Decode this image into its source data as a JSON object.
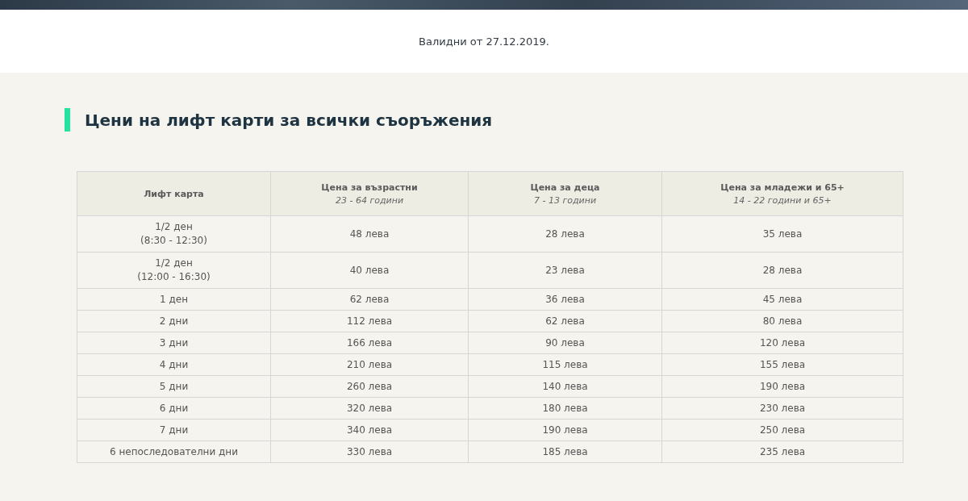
{
  "valid_from": "Валидни от 27.12.2019.",
  "section_title": "Цени на лифт карти за всички съоръжения",
  "table": {
    "columns": [
      {
        "title": "Лифт карта"
      },
      {
        "title": "Цена за възрастни",
        "subtitle": "23 - 64 години"
      },
      {
        "title": "Цена за деца",
        "subtitle": "7 - 13 години"
      },
      {
        "title": "Цена за младежи и 65+",
        "subtitle": "14 - 22 години и 65+"
      }
    ],
    "rows": [
      [
        "1/2 ден\n(8:30 - 12:30)",
        "48 лева",
        "28 лева",
        "35 лева"
      ],
      [
        "1/2 ден\n(12:00 - 16:30)",
        "40 лева",
        "23 лева",
        "28 лева"
      ],
      [
        "1 ден",
        "62 лева",
        "36 лева",
        "45 лева"
      ],
      [
        "2 дни",
        "112 лева",
        "62 лева",
        "80 лева"
      ],
      [
        "3 дни",
        "166 лева",
        "90 лева",
        "120 лева"
      ],
      [
        "4 дни",
        "210 лева",
        "115 лева",
        "155 лева"
      ],
      [
        "5 дни",
        "260 лева",
        "140 лева",
        "190 лева"
      ],
      [
        "6 дни",
        "320 лева",
        "180 лева",
        "230 лева"
      ],
      [
        "7 дни",
        "340 лева",
        "190 лева",
        "250 лева"
      ],
      [
        "6 непоследователни дни",
        "330 лева",
        "185 лева",
        "235 лева"
      ]
    ]
  }
}
